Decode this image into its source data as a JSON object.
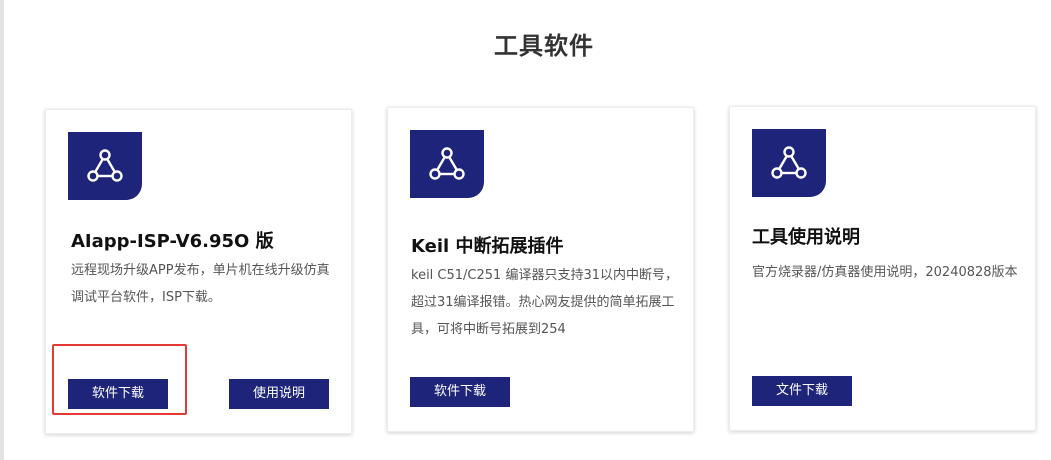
{
  "page": {
    "section_title": "工具软件"
  },
  "cards": [
    {
      "icon": "share-nodes-icon",
      "title": "AIapp-ISP-V6.95O 版",
      "description": "远程现场升级APP发布，单片机在线升级仿真调试平台软件，ISP下载。",
      "buttons": [
        {
          "label": "软件下载"
        },
        {
          "label": "使用说明"
        }
      ]
    },
    {
      "icon": "share-nodes-icon",
      "title": "Keil 中断拓展插件",
      "description": "keil C51/C251 编译器只支持31以内中断号，超过31编译报错。热心网友提供的简单拓展工具，可将中断号拓展到254",
      "buttons": [
        {
          "label": "软件下载"
        }
      ]
    },
    {
      "icon": "share-nodes-icon",
      "title": "工具使用说明",
      "description": "官方烧录器/仿真器使用说明，20240828版本",
      "buttons": [
        {
          "label": "文件下载"
        }
      ]
    }
  ],
  "colors": {
    "brand": "#1e2479",
    "highlight": "#e53935"
  }
}
